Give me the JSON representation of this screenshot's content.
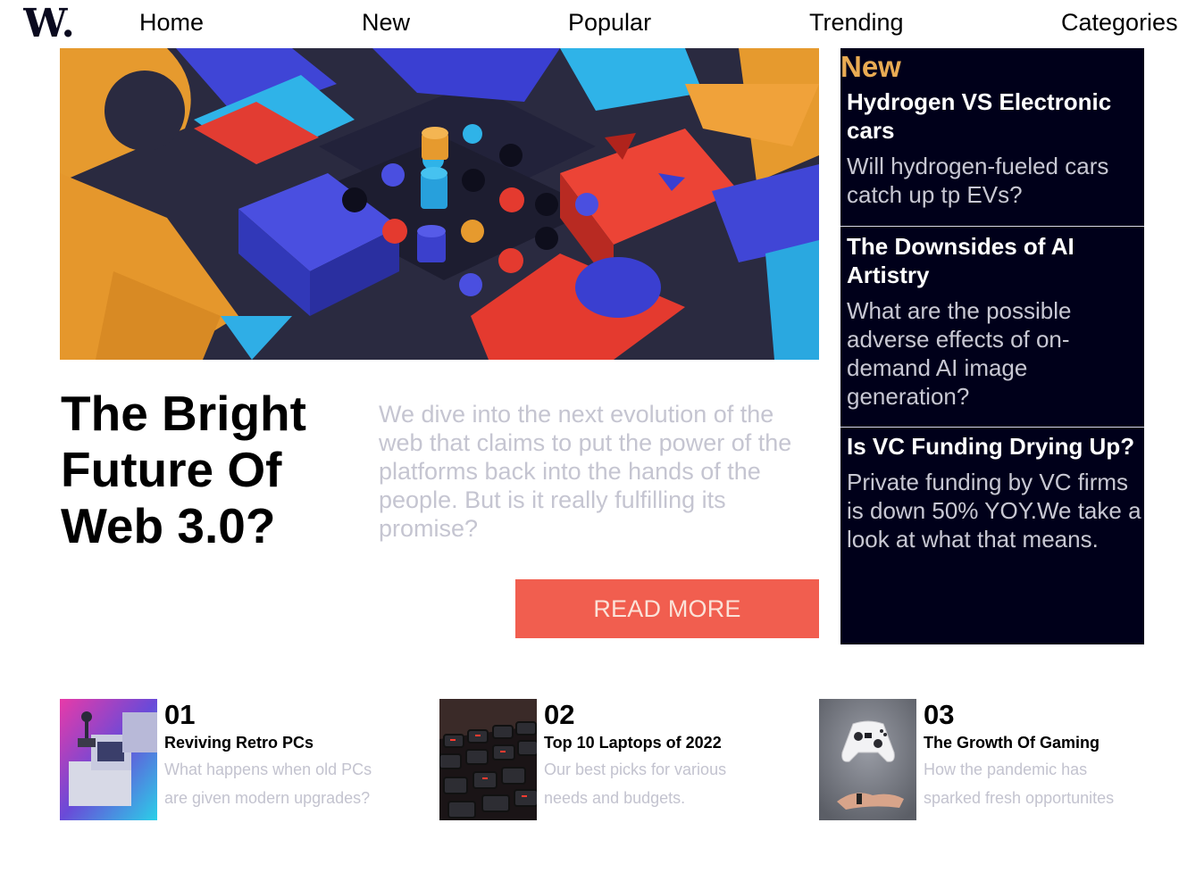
{
  "brand": {
    "logo_text": "W."
  },
  "nav": {
    "items": [
      {
        "label": "Home"
      },
      {
        "label": "New"
      },
      {
        "label": "Popular"
      },
      {
        "label": "Trending"
      },
      {
        "label": "Categories"
      }
    ]
  },
  "hero": {
    "title": "The Bright Future Of Web 3.0?",
    "description": "We dive into the next evolution of the web that claims to put the power of the platforms back into the hands of the people. But is it really fulfilling its promise?",
    "button_label": "READ MORE"
  },
  "new_panel": {
    "heading": "New",
    "items": [
      {
        "title": "Hydrogen VS Electronic cars",
        "description": "Will hydrogen-fueled cars catch up tp EVs?"
      },
      {
        "title": "The Downsides of AI Artistry",
        "description": "What are the possible adverse effects of on-demand AI image generation?"
      },
      {
        "title": "Is VC Funding Drying Up?",
        "description": "Private funding by VC firms is down 50% YOY.We take a look at what that means."
      }
    ]
  },
  "articles": [
    {
      "number": "01",
      "title": "Reviving Retro PCs",
      "description": "What happens when old PCs are given modern upgrades?"
    },
    {
      "number": "02",
      "title": "Top 10 Laptops of 2022",
      "description": "Our best picks for various needs and budgets."
    },
    {
      "number": "03",
      "title": "The Growth Of Gaming",
      "description": "How the pandemic has sparked fresh opportunites"
    }
  ],
  "colors": {
    "accent": "#f15e4f",
    "panel_bg": "#00001a",
    "new_heading": "#e9ab53",
    "muted_text": "#c5c5d1"
  }
}
